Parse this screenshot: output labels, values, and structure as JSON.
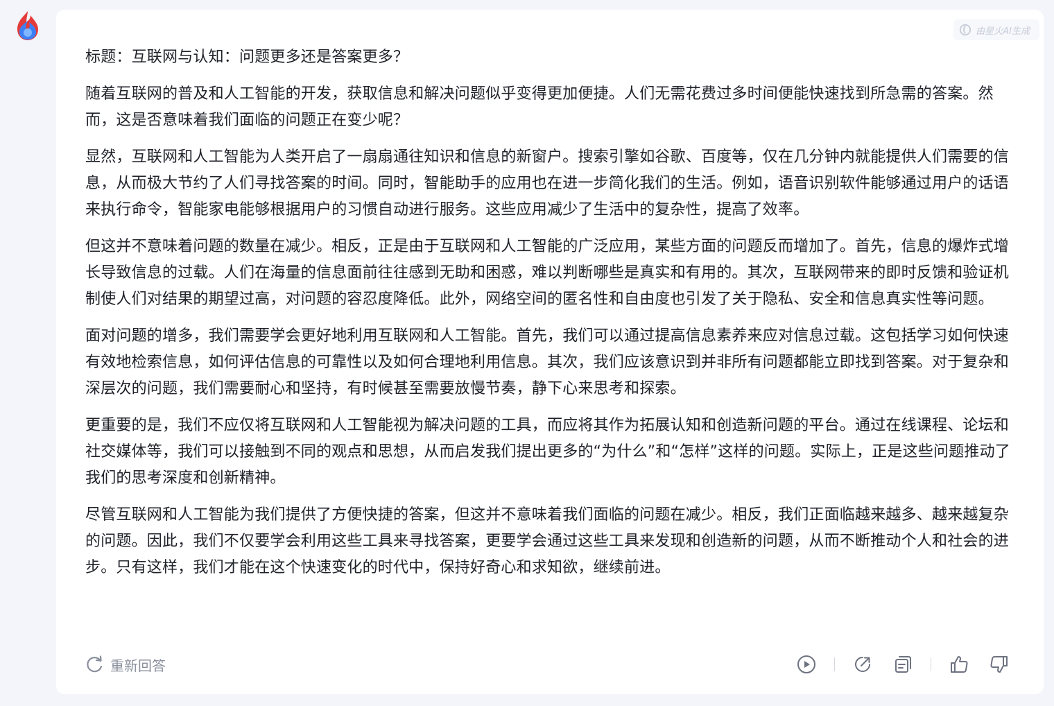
{
  "brand": {
    "logo_icon": "spark-flame-logo-icon",
    "colors": {
      "red": "#e53a3a",
      "blue": "#3d7ff5",
      "light_blue": "#7fb6ff"
    }
  },
  "badge": {
    "text": "由星火AI生成",
    "icon": "spark-swirl-icon"
  },
  "article": {
    "title": "标题：互联网与认知：问题更多还是答案更多？",
    "paragraphs": [
      "随着互联网的普及和人工智能的开发，获取信息和解决问题似乎变得更加便捷。人们无需花费过多时间便能快速找到所急需的答案。然而，这是否意味着我们面临的问题正在变少呢？",
      "显然，互联网和人工智能为人类开启了一扇扇通往知识和信息的新窗户。搜索引擎如谷歌、百度等，仅在几分钟内就能提供人们需要的信息，从而极大节约了人们寻找答案的时间。同时，智能助手的应用也在进一步简化我们的生活。例如，语音识别软件能够通过用户的话语来执行命令，智能家电能够根据用户的习惯自动进行服务。这些应用减少了生活中的复杂性，提高了效率。",
      "但这并不意味着问题的数量在减少。相反，正是由于互联网和人工智能的广泛应用，某些方面的问题反而增加了。首先，信息的爆炸式增长导致信息的过载。人们在海量的信息面前往往感到无助和困惑，难以判断哪些是真实和有用的。其次，互联网带来的即时反馈和验证机制使人们对结果的期望过高，对问题的容忍度降低。此外，网络空间的匿名性和自由度也引发了关于隐私、安全和信息真实性等问题。",
      "面对问题的增多，我们需要学会更好地利用互联网和人工智能。首先，我们可以通过提高信息素养来应对信息过载。这包括学习如何快速有效地检索信息，如何评估信息的可靠性以及如何合理地利用信息。其次，我们应该意识到并非所有问题都能立即找到答案。对于复杂和深层次的问题，我们需要耐心和坚持，有时候甚至需要放慢节奏，静下心来思考和探索。",
      "更重要的是，我们不应仅将互联网和人工智能视为解决问题的工具，而应将其作为拓展认知和创造新问题的平台。通过在线课程、论坛和社交媒体等，我们可以接触到不同的观点和思想，从而启发我们提出更多的“为什么”和“怎样”这样的问题。实际上，正是这些问题推动了我们的思考深度和创新精神。",
      "尽管互联网和人工智能为我们提供了方便快捷的答案，但这并不意味着我们面临的问题在减少。相反，我们正面临越来越多、越来越复杂的问题。因此，我们不仅要学会利用这些工具来寻找答案，更要学会通过这些工具来发现和创造新的问题，从而不断推动个人和社会的进步。只有这样，我们才能在这个快速变化的时代中，保持好奇心和求知欲，继续前进。"
    ]
  },
  "footer": {
    "regenerate_label": "重新回答",
    "regenerate_icon": "refresh-icon",
    "actions": [
      "play-audio-icon",
      "share-icon",
      "copy-icon",
      "thumbs-up-icon",
      "thumbs-down-icon"
    ]
  }
}
